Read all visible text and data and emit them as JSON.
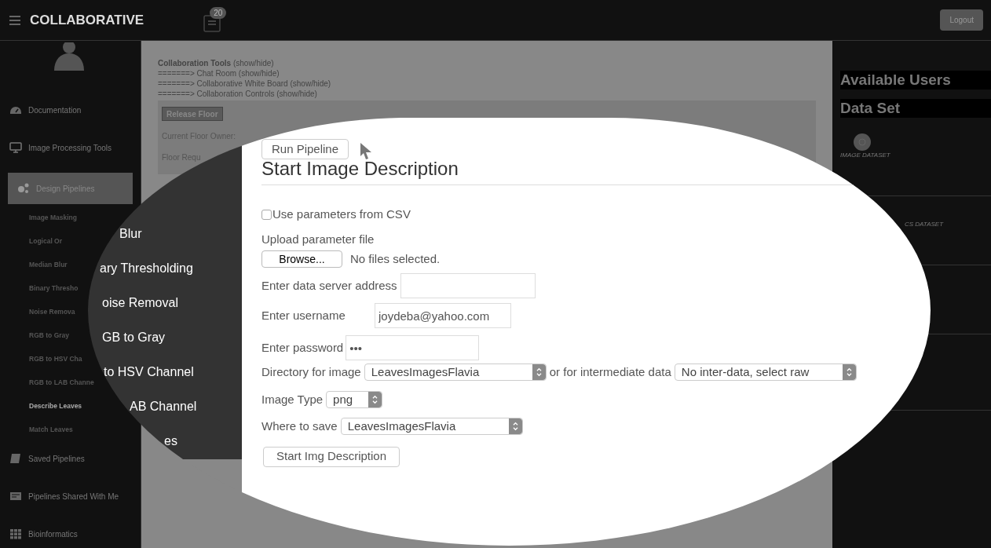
{
  "header": {
    "title": "COLLABORATIVE",
    "notification_count": "20",
    "logout": "Logout"
  },
  "sidebar": {
    "items": [
      {
        "label": "Documentation",
        "selected": false
      },
      {
        "label": "Image Processing Tools",
        "selected": false
      },
      {
        "label": "Design Pipelines",
        "selected": true,
        "children": [
          {
            "label": "Image Masking",
            "selected": false
          },
          {
            "label": "Logical Or",
            "selected": false
          },
          {
            "label": "Median Blur",
            "selected": false
          },
          {
            "label": "Binary Thresho",
            "selected": false
          },
          {
            "label": "Noise Remova",
            "selected": false
          },
          {
            "label": "RGB to Gray",
            "selected": false
          },
          {
            "label": "RGB to HSV Cha",
            "selected": false
          },
          {
            "label": "RGB to LAB Channe",
            "selected": false
          },
          {
            "label": "Describe Leaves",
            "selected": true
          },
          {
            "label": "Match Leaves",
            "selected": false
          }
        ]
      },
      {
        "label": "Saved Pipelines",
        "selected": false
      },
      {
        "label": "Pipelines Shared With Me",
        "selected": false
      },
      {
        "label": "Bioinformatics",
        "selected": false
      }
    ]
  },
  "collaboration": {
    "lines": [
      {
        "kind": "heading",
        "label": "Collaboration Tools",
        "toggle": "(show/hide)"
      },
      {
        "kind": "sub",
        "prefix": "=======>",
        "label": "Chat Room",
        "toggle": "(show/hide)"
      },
      {
        "kind": "sub",
        "prefix": "=======>",
        "label": "Collaborative White Board",
        "toggle": "(show/hide)"
      },
      {
        "kind": "sub",
        "prefix": "=======>",
        "label": "Collaboration Controls",
        "toggle": "(show/hide)"
      }
    ],
    "release_button": "Release Floor",
    "owner_label": "Current Floor Owner:",
    "requests_label": "Floor Requ"
  },
  "right_panel": {
    "headings": [
      "Available Users",
      "Data Set"
    ],
    "datasets": [
      {
        "caption": "IMAGE DATASET"
      },
      {
        "caption": "CS DATASET"
      }
    ]
  },
  "magnifier": {
    "sidebar_fragments": [
      "Blur",
      "ary Thresholding",
      "oise Removal",
      "GB to Gray",
      "to HSV Channel",
      "AB Channel",
      "es"
    ],
    "run_button": "Run Pipeline",
    "title": "Start Image Description",
    "csv": {
      "label": "Use parameters from CSV",
      "checked": false
    },
    "upload_label": "Upload parameter file",
    "browse_button": "Browse...",
    "file_status": "No files selected.",
    "server_label": "Enter data server address",
    "username": {
      "label": "Enter username",
      "value": "joydeba@yahoo.com"
    },
    "password": {
      "label": "Enter password",
      "value": "•••"
    },
    "directory": {
      "label": "Directory for image",
      "value": "LeavesImagesFlavia"
    },
    "intermediate": {
      "label": "or for intermediate data",
      "value": "No inter-data, select raw"
    },
    "image_type": {
      "label": "Image Type",
      "value": "png"
    },
    "save": {
      "label": "Where to save",
      "value": "LeavesImagesFlavia"
    },
    "submit_button": "Start Img Description"
  }
}
